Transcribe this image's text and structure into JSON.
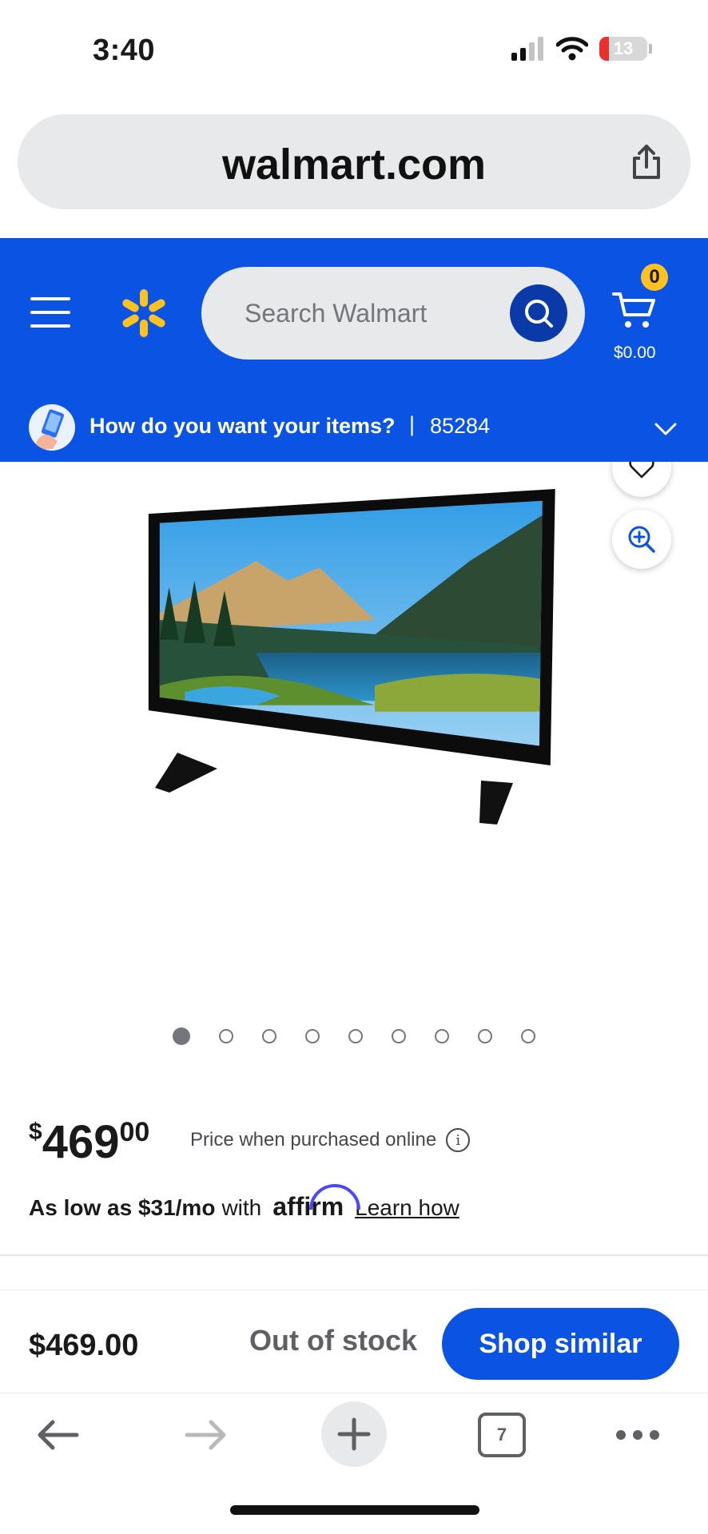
{
  "status_bar": {
    "time": "3:40",
    "battery": "13"
  },
  "browser": {
    "url": "walmart.com",
    "tab_count": "7"
  },
  "header": {
    "search_placeholder": "Search Walmart",
    "cart_count": "0",
    "cart_total": "$0.00",
    "fulfillment_question": "How do you want your items?",
    "separator": "|",
    "zip": "85284"
  },
  "colors": {
    "brand_blue": "#0a53e3",
    "spark_yellow": "#ffc220",
    "search_button": "#0a3aa8"
  },
  "gallery": {
    "image_count": 9,
    "active_index": 0
  },
  "product": {
    "currency_symbol": "$",
    "price_dollars": "469",
    "price_cents": "00",
    "price_note": "Price when purchased online",
    "affirm_prefix": "As low as $31/mo",
    "affirm_with": "with",
    "affirm_brand": "affirm",
    "affirm_link": "Learn how"
  },
  "sticky_bar": {
    "price": "$469.00",
    "stock_status": "Out of stock",
    "cta": "Shop similar"
  }
}
